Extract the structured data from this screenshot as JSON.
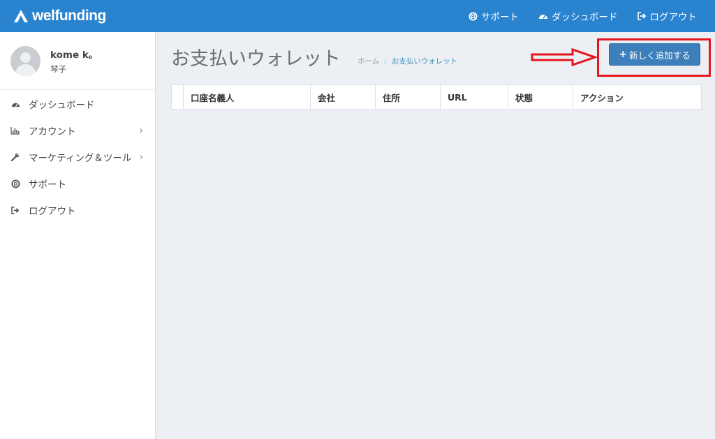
{
  "app": {
    "logo_text": "welfunding"
  },
  "topnav": {
    "support": "サポート",
    "dashboard": "ダッシュボード",
    "logout": "ログアウト"
  },
  "user": {
    "name": "kome k。",
    "sub": "琴子"
  },
  "sidebar": {
    "items": [
      {
        "label": "ダッシュボード",
        "icon": "dashboard-icon"
      },
      {
        "label": "アカウント",
        "icon": "bar-chart-icon",
        "has_children": true
      },
      {
        "label": "マーケティング＆ツール",
        "icon": "wrench-icon",
        "has_children": true
      },
      {
        "label": "サポート",
        "icon": "lifebuoy-icon"
      },
      {
        "label": "ログアウト",
        "icon": "sign-out-icon"
      }
    ]
  },
  "main": {
    "title": "お支払いウォレット",
    "breadcrumb": {
      "home": "ホーム",
      "sep": "/",
      "current": "お支払いウォレット"
    },
    "add_button": "新しく追加する",
    "table": {
      "columns": [
        "",
        "口座名義人",
        "会社",
        "住所",
        "URL",
        "状態",
        "アクション"
      ],
      "rows": []
    }
  },
  "colors": {
    "topbar": "#2a83cf",
    "button": "#3c7fba",
    "annotation": "#e8141c",
    "background": "#ecf0f5"
  }
}
